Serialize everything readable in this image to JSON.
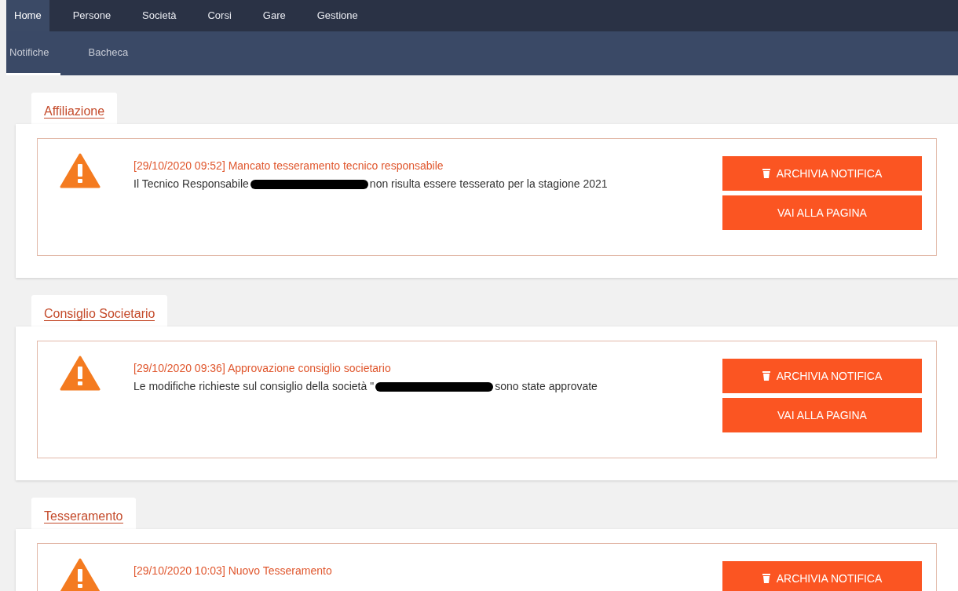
{
  "nav": {
    "items": [
      {
        "label": "Home",
        "selected": true
      },
      {
        "label": "Persone",
        "selected": false
      },
      {
        "label": "Società",
        "selected": false
      },
      {
        "label": "Corsi",
        "selected": false
      },
      {
        "label": "Gare",
        "selected": false
      },
      {
        "label": "Gestione",
        "selected": false
      }
    ]
  },
  "subnav": {
    "items": [
      {
        "label": "Notifiche",
        "selected": true
      },
      {
        "label": "Bacheca",
        "selected": false
      }
    ]
  },
  "sections": [
    {
      "title": "Affiliazione",
      "notifications": [
        {
          "title": "[29/10/2020 09:52] Mancato tesseramento tecnico responsabile",
          "text_before": "Il Tecnico Responsabile",
          "redacted": true,
          "text_after": "non risulta essere tesserato per la stagione 2021",
          "archive_button": "ARCHIVIA NOTIFICA",
          "goto_button": "VAI ALLA PAGINA"
        }
      ]
    },
    {
      "title": "Consiglio Societario",
      "notifications": [
        {
          "title": "[29/10/2020 09:36] Approvazione consiglio societario",
          "text_before": "Le modifiche richieste sul consiglio della società \"",
          "redacted": true,
          "text_after": "sono state approvate",
          "archive_button": "ARCHIVIA NOTIFICA",
          "goto_button": "VAI ALLA PAGINA"
        }
      ]
    },
    {
      "title": "Tesseramento",
      "notifications": [
        {
          "title": "[29/10/2020 10:03] Nuovo Tesseramento",
          "archive_button": "ARCHIVIA NOTIFICA"
        }
      ]
    }
  ]
}
